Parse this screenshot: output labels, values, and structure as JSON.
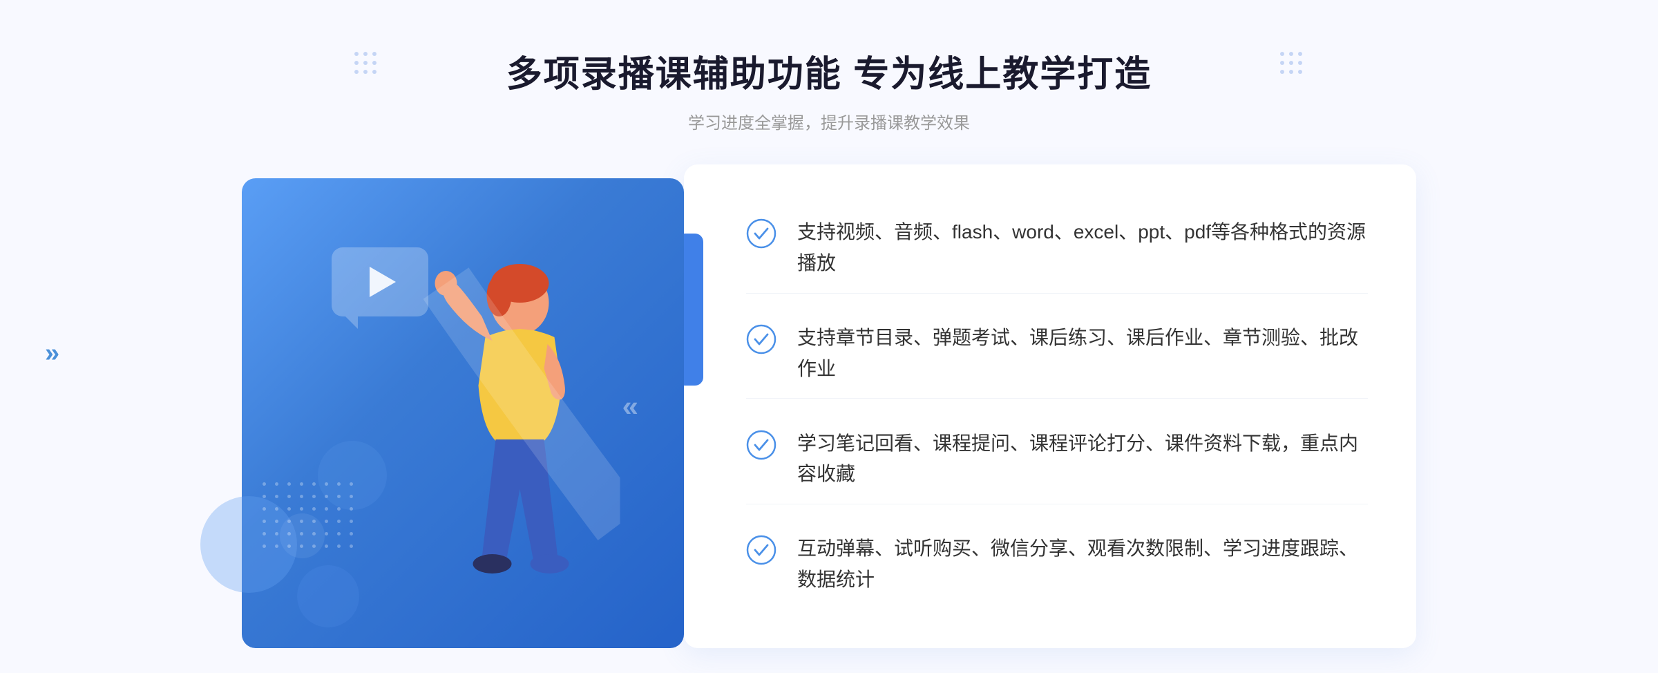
{
  "header": {
    "title": "多项录播课辅助功能 专为线上教学打造",
    "subtitle": "学习进度全掌握，提升录播课教学效果",
    "deco_left_label": "deco-dots-left",
    "deco_right_label": "deco-dots-right"
  },
  "features": [
    {
      "id": 1,
      "text": "支持视频、音频、flash、word、excel、ppt、pdf等各种格式的资源播放"
    },
    {
      "id": 2,
      "text": "支持章节目录、弹题考试、课后练习、课后作业、章节测验、批改作业"
    },
    {
      "id": 3,
      "text": "学习笔记回看、课程提问、课程评论打分、课件资料下载，重点内容收藏"
    },
    {
      "id": 4,
      "text": "互动弹幕、试听购买、微信分享、观看次数限制、学习进度跟踪、数据统计"
    }
  ],
  "image_panel": {
    "alt": "录播课功能插图"
  },
  "arrows": {
    "left_arrow": "»"
  }
}
